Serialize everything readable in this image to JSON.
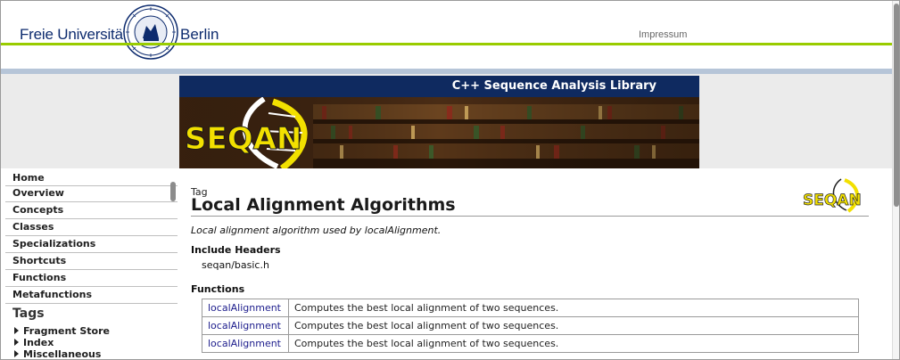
{
  "fu_header": {
    "name_left": "Freie Universität",
    "name_right": "Berlin",
    "impressum": "Impressum"
  },
  "banner": {
    "title": "C++ Sequence Analysis Library",
    "logo_text": "SEQAN"
  },
  "sidebar": {
    "items": [
      {
        "label": "Home"
      },
      {
        "label": "Overview"
      },
      {
        "label": "Concepts"
      },
      {
        "label": "Classes"
      },
      {
        "label": "Specializations"
      },
      {
        "label": "Shortcuts"
      },
      {
        "label": "Functions"
      },
      {
        "label": "Metafunctions"
      }
    ],
    "tags_heading": "Tags",
    "tags": [
      {
        "label": "Fragment Store"
      },
      {
        "label": "Index"
      },
      {
        "label": "Miscellaneous"
      }
    ]
  },
  "main": {
    "kind": "Tag",
    "title": "Local Alignment Algorithms",
    "description": "Local alignment algorithm used by localAlignment.",
    "include_heading": "Include Headers",
    "include_value": "seqan/basic.h",
    "functions_heading": "Functions",
    "functions": [
      {
        "name": "localAlignment",
        "desc": "Computes the best local alignment of two sequences."
      },
      {
        "name": "localAlignment",
        "desc": "Computes the best local alignment of two sequences."
      },
      {
        "name": "localAlignment",
        "desc": "Computes the best local alignment of two sequences."
      }
    ],
    "mini_logo_text": "SEQAN"
  },
  "colors": {
    "fu_blue": "#0d2b6e",
    "green_accent": "#99cc00",
    "banner_navy": "#0f2a60",
    "seqan_yellow": "#f2e000"
  }
}
